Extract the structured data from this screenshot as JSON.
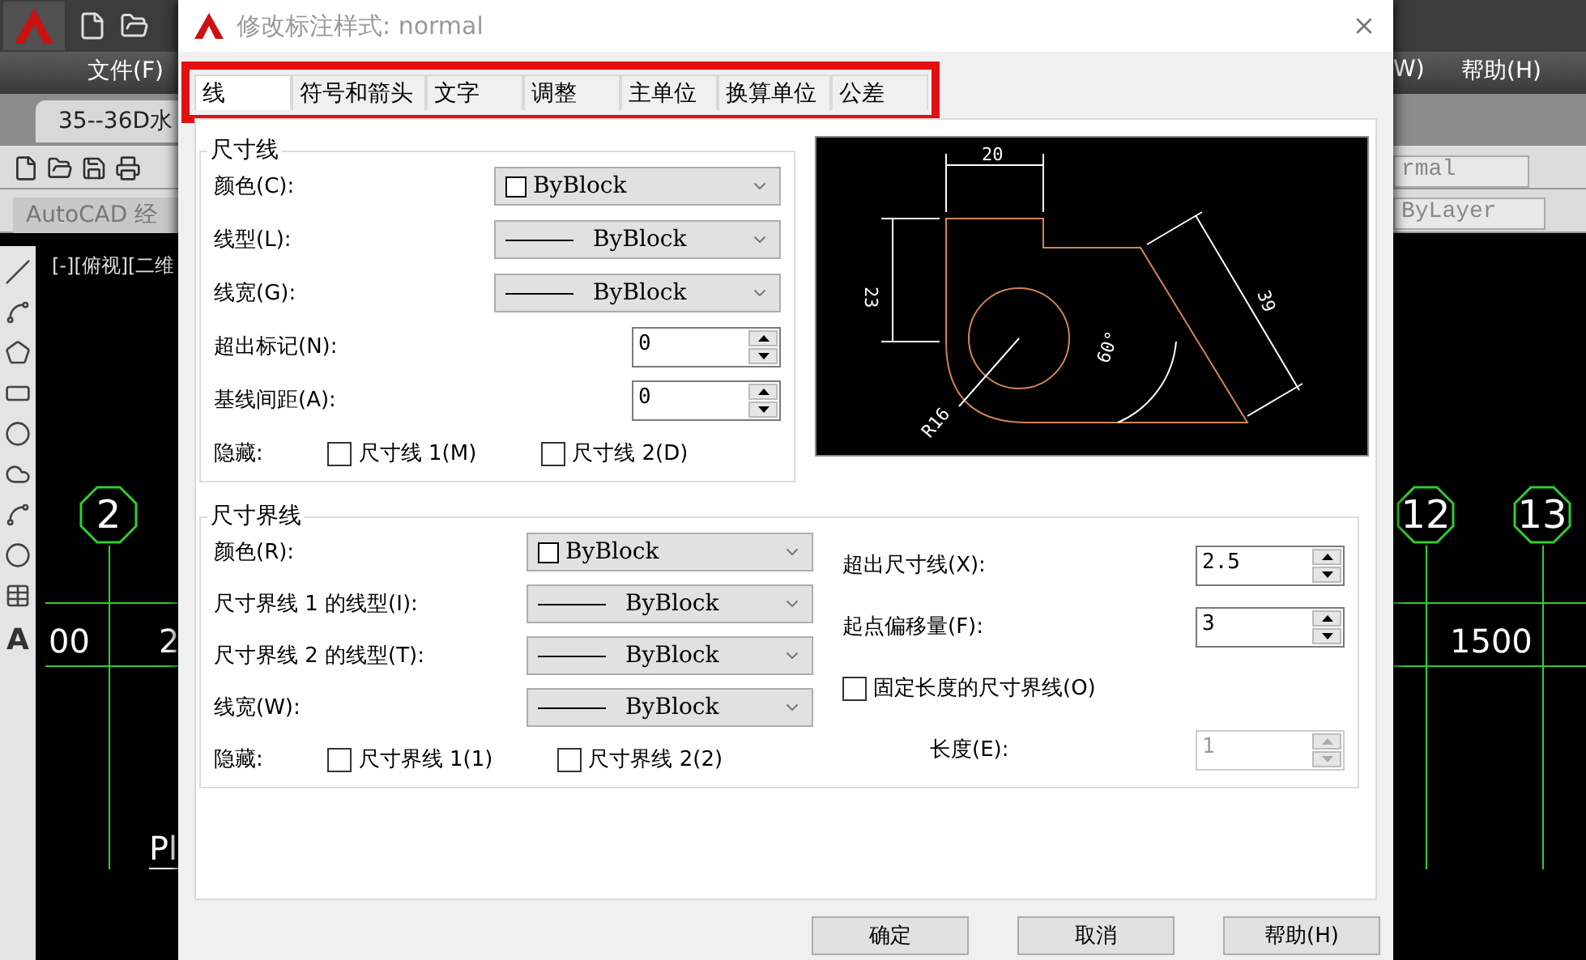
{
  "app": {
    "menu": [
      "文件(F)",
      "W)",
      "帮助(H)"
    ],
    "doc_tab": "35--36D水",
    "workspace": "AutoCAD 经",
    "style_combo": "rmal",
    "layer_combo": "ByLayer",
    "viewport_label": "[-][俯视][二维",
    "palette_text": "A"
  },
  "canvas": {
    "left": {
      "bubbles": [
        "2"
      ],
      "dims": [
        "00",
        "2"
      ],
      "label": "Pl"
    },
    "right": {
      "bubbles": [
        "12",
        "13"
      ],
      "dims": [
        "1500"
      ]
    }
  },
  "dialog": {
    "title": "修改标注样式: normal",
    "tabs": [
      {
        "label": "线",
        "selected": true
      },
      {
        "label": "符号和箭头",
        "selected": false
      },
      {
        "label": "文字",
        "selected": false
      },
      {
        "label": "调整",
        "selected": false
      },
      {
        "label": "主单位",
        "selected": false
      },
      {
        "label": "换算单位",
        "selected": false
      },
      {
        "label": "公差",
        "selected": false
      }
    ],
    "dim_lines": {
      "title": "尺寸线",
      "rows": [
        {
          "kind": "dropdown",
          "label": "颜色(C):",
          "value": "ByBlock",
          "swatch": true
        },
        {
          "kind": "dropdown",
          "label": "线型(L):",
          "value": "ByBlock",
          "swatch": false
        },
        {
          "kind": "dropdown",
          "label": "线宽(G):",
          "value": "ByBlock",
          "swatch": false
        },
        {
          "kind": "spinner",
          "label": "超出标记(N):",
          "value": "0",
          "disabled": false
        },
        {
          "kind": "spinner",
          "label": "基线间距(A):",
          "value": "0",
          "disabled": false
        }
      ],
      "hide_label": "隐藏:",
      "hide": [
        {
          "label": "尺寸线 1(M)",
          "checked": false
        },
        {
          "label": "尺寸线 2(D)",
          "checked": false
        }
      ]
    },
    "preview": {
      "labels": [
        "20",
        "23",
        "39",
        "60°",
        "R16"
      ]
    },
    "ext_lines": {
      "title": "尺寸界线",
      "rows": [
        {
          "kind": "dropdown",
          "label": "颜色(R):",
          "value": "ByBlock",
          "swatch": true
        },
        {
          "kind": "dropdown",
          "label": "尺寸界线 1 的线型(I):",
          "value": "ByBlock",
          "swatch": false
        },
        {
          "kind": "dropdown",
          "label": "尺寸界线 2 的线型(T):",
          "value": "ByBlock",
          "swatch": false
        },
        {
          "kind": "dropdown",
          "label": "线宽(W):",
          "value": "ByBlock",
          "swatch": false
        }
      ],
      "hide_label": "隐藏:",
      "hide": [
        {
          "label": "尺寸界线 1(1)",
          "checked": false
        },
        {
          "label": "尺寸界线 2(2)",
          "checked": false
        }
      ],
      "right": [
        {
          "kind": "spinner",
          "label": "超出尺寸线(X):",
          "value": "2.5",
          "disabled": false
        },
        {
          "kind": "spinner",
          "label": "起点偏移量(F):",
          "value": "3",
          "disabled": false
        },
        {
          "kind": "checkbox",
          "label": "固定长度的尺寸界线(O)",
          "checked": false
        },
        {
          "kind": "spinner",
          "label": "长度(E):",
          "value": "1",
          "disabled": true
        }
      ]
    },
    "buttons": [
      "确定",
      "取消",
      "帮助(H)"
    ]
  }
}
